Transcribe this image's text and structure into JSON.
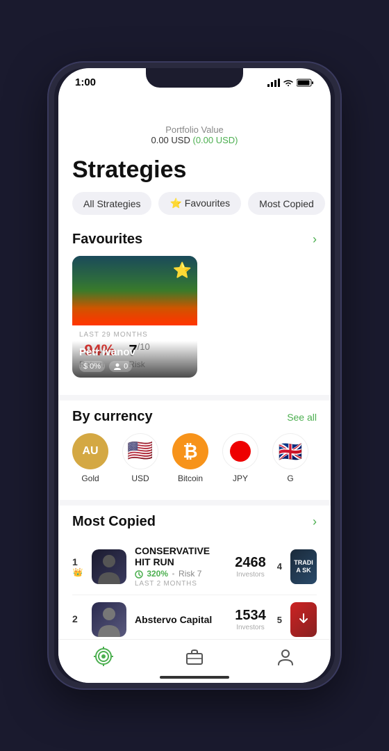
{
  "statusBar": {
    "time": "1:00",
    "timeIcon": "location-arrow-icon"
  },
  "header": {
    "portfolioLabel": "Portfolio Value",
    "portfolioValue": "0.00 USD",
    "portfolioChange": "(0.00 USD)"
  },
  "page": {
    "title": "Strategies"
  },
  "filterTabs": [
    {
      "id": "all",
      "label": "All Strategies",
      "active": false
    },
    {
      "id": "favourites",
      "label": "⭐ Favourites",
      "active": false
    },
    {
      "id": "mostCopied",
      "label": "Most Copied",
      "active": false
    }
  ],
  "favourites": {
    "sectionTitle": "Favourites",
    "arrowIcon": "chevron-right-icon",
    "items": [
      {
        "id": "petr-ivanov",
        "name": "Petr Ivanov",
        "returnBadge": "$ 0%",
        "followersBadge": "0",
        "lastMonths": "LAST 29 MONTHS",
        "returnValue": "-94%",
        "returnLabel": "Return",
        "riskValue": "7",
        "riskSub": "/10",
        "riskLabel": "Risk",
        "starred": true
      }
    ]
  },
  "byCurrency": {
    "sectionTitle": "By currency",
    "seeAllLabel": "See all",
    "items": [
      {
        "id": "gold",
        "label": "Gold",
        "symbol": "AU",
        "bg": "#d4a843",
        "textColor": "white"
      },
      {
        "id": "usd",
        "label": "USD",
        "symbol": "🇺🇸",
        "bg": "#f0f0f0",
        "textColor": "#333"
      },
      {
        "id": "bitcoin",
        "label": "Bitcoin",
        "symbol": "₿",
        "bg": "#f7931a",
        "textColor": "white"
      },
      {
        "id": "jpy",
        "label": "JPY",
        "symbol": "🔴",
        "bg": "#ffffff",
        "textColor": "#333"
      },
      {
        "id": "gbp",
        "label": "G",
        "symbol": "🇬🇧",
        "bg": "#f0f0f0",
        "textColor": "#333"
      }
    ]
  },
  "mostCopied": {
    "sectionTitle": "Most Copied",
    "arrowIcon": "chevron-right-icon",
    "items": [
      {
        "rank": "1",
        "name": "CONSERVATIVE HIT RUN",
        "returnValue": "320%",
        "riskLabel": "Risk 7",
        "lastMonths": "LAST 2 MONTHS",
        "investors": "2468",
        "investorsLabel": "Investors",
        "badgeRank": "4",
        "badgeText": "TRADI\nA SK"
      },
      {
        "rank": "2",
        "name": "Abstervo Capital",
        "returnValue": "",
        "riskLabel": "",
        "lastMonths": "",
        "investors": "1534",
        "investorsLabel": "Investors",
        "badgeRank": "5",
        "badgeText": ""
      }
    ]
  },
  "bottomNav": [
    {
      "id": "strategies",
      "icon": "target-icon",
      "active": true
    },
    {
      "id": "portfolio",
      "icon": "briefcase-icon",
      "active": false
    },
    {
      "id": "profile",
      "icon": "person-icon",
      "active": false
    }
  ]
}
